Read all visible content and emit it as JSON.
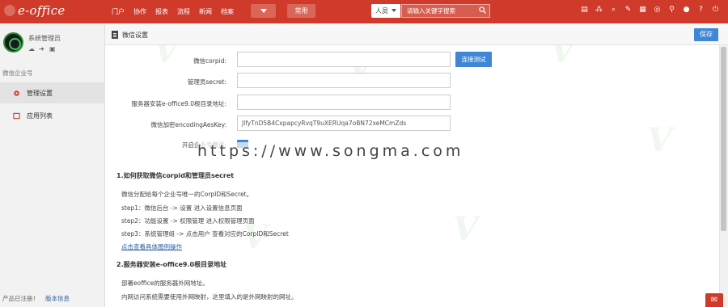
{
  "header": {
    "logo": "e-office",
    "nav": [
      "门户",
      "协作",
      "报表",
      "流程",
      "新闻",
      "档案"
    ],
    "common_label": "常用",
    "search_scope": "人员",
    "search_placeholder": "请输入关键字搜索"
  },
  "sidebar": {
    "username": "系统管理员",
    "group_title": "微信企业号",
    "items": [
      {
        "label": "管理设置",
        "active": true
      },
      {
        "label": "应用列表",
        "active": false
      }
    ],
    "footer_text": "产品已注册！",
    "footer_link": "版本信息"
  },
  "page": {
    "title": "微信设置",
    "save_label": "保存"
  },
  "form": {
    "corpid_label": "微信corpid:",
    "corpid_value": "",
    "test_button": "连接测试",
    "secret_label": "管理员secret:",
    "secret_value": "",
    "address_label": "服务器安装e-office9.0根目录地址:",
    "address_value": "",
    "aeskey_label": "微信加密encodingAesKey:",
    "aeskey_value": "JlfyTnD5B4CxpapcyRvqT9uXERUqa7oBN72xeMCmZds",
    "toggle_label": "开启企业号推送:"
  },
  "watermark": "https://www.songma.com",
  "sections": [
    {
      "title": "1.如何获取微信corpid和管理员secret",
      "lines": [
        "微信分配给每个企业号唯一的CorpID和Secret。",
        "step1：微信后台 -> 设置 进入设置信息页面",
        "step2：功能设置 -> 权限管理 进入权限管理页面",
        "step3：系统管理组 -> 点击用户 查看对应的CorpID和Secret"
      ],
      "link": "点击查看具体图例操作"
    },
    {
      "title": "2.服务器安装e-office9.0根目录地址",
      "lines": [
        "部署eoffice的服务器外网地址。",
        "内网访问系统需要使用外网映射，这里填入的是外网映射的网址。"
      ]
    }
  ],
  "colors": {
    "brand_red": "#d03a2b",
    "accent_blue": "#3f87d6"
  }
}
